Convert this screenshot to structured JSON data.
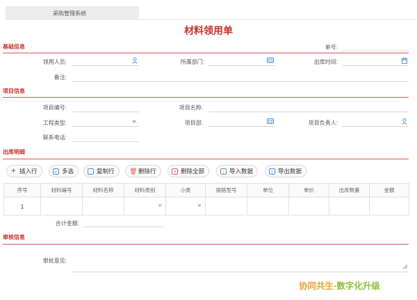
{
  "app": {
    "system_tab": "采购管理系统"
  },
  "form": {
    "title": "材料领用单"
  },
  "sections": {
    "basic": "基础信息",
    "project": "项目信息",
    "outbound": "出库明细",
    "review": "审核信息"
  },
  "basic": {
    "order_no_label": "单号:",
    "order_no_value": "",
    "recipient_label": "领用人员:",
    "recipient_value": "",
    "dept_label": "所属部门:",
    "dept_value": "",
    "outbound_time_label": "出库时间:",
    "outbound_time_value": "",
    "remark_label": "备注:",
    "remark_value": ""
  },
  "project": {
    "code_label": "项目编号:",
    "code_value": "",
    "name_label": "项目名称:",
    "name_value": "",
    "type_label": "工程类型:",
    "type_value": "",
    "dept_label": "项目部:",
    "dept_value": "",
    "owner_label": "项目负责人:",
    "owner_value": "",
    "phone_label": "联系电话:",
    "phone_value": ""
  },
  "toolbar": {
    "insert_row": "插入行",
    "multi_select": "多选",
    "copy_row": "复制行",
    "delete_row": "删除行",
    "delete_all": "删除全部",
    "import_data": "导入数据",
    "export_data": "导出数据"
  },
  "table": {
    "headers": [
      "序号",
      "材料编号",
      "材料名称",
      "材料类别",
      "小类",
      "规格型号",
      "单位",
      "单价",
      "出库数量",
      "金额"
    ],
    "rows": [
      {
        "seq": "1"
      }
    ],
    "total_label": "合计金额:",
    "total_value": ""
  },
  "review": {
    "opinion_label": "审批意见:",
    "opinion_value": ""
  },
  "watermark": {
    "part1": "协同共生",
    "part2": "·数字化升级"
  },
  "colors": {
    "accent": "#c9302c",
    "icon": "#4a90d9"
  },
  "icons": {
    "person": "person-icon",
    "calendar": "calendar-icon",
    "picker": "picker-icon"
  }
}
